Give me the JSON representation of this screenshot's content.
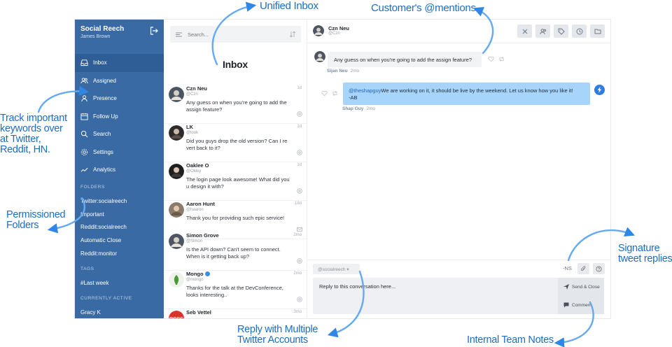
{
  "callouts": {
    "unified_inbox": "Unified Inbox",
    "customers_mentions": "Customer's @mentions",
    "track_keywords": "Track important keywords over at Twitter, Reddit, HN.",
    "permissioned_folders": "Permissioned Folders",
    "signature_replies": "Signature tweet replies",
    "reply_multiple": "Reply with Multiple Twitter Accounts",
    "team_notes": "Internal Team Notes",
    "inbox_label": "Inbox"
  },
  "sidebar": {
    "brand": "Social Reech",
    "user": "James Brown",
    "nav": [
      {
        "label": "Inbox",
        "icon": "inbox-icon",
        "active": true
      },
      {
        "label": "Assigned",
        "icon": "users-icon"
      },
      {
        "label": "Presence",
        "icon": "presence-icon"
      },
      {
        "label": "Follow Up",
        "icon": "calendar-icon"
      },
      {
        "label": "Search",
        "icon": "search-icon"
      },
      {
        "label": "Settings",
        "icon": "gear-icon"
      },
      {
        "label": "Analytics",
        "icon": "analytics-icon"
      }
    ],
    "folders_label": "FOLDERS",
    "folders": [
      "Twitter:socialreech",
      "Important",
      "Reddit:socialreech",
      "Automatic Close",
      "Reddit:monitor"
    ],
    "tags_label": "TAGS",
    "tags": [
      "#Last week"
    ],
    "active_label": "CURRENTLY ACTIVE",
    "active_users": [
      "Gracy K"
    ]
  },
  "list": {
    "search_placeholder": "Search...",
    "conversations": [
      {
        "name": "Czn Neu",
        "handle": "@Czn",
        "time": "1d",
        "text": "Any guess on when you're going to add the assign feature?",
        "icon": "at-icon"
      },
      {
        "name": "LK",
        "handle": "@look",
        "time": "1d",
        "text": "Did you guys drop the old version? Can I re vert back to it?",
        "icon": "at-icon"
      },
      {
        "name": "Oaklee O",
        "handle": "@Okley",
        "time": "1d",
        "text": "The login page look awesome! What did you u design it with?",
        "icon": "at-icon"
      },
      {
        "name": "Aaron Hunt",
        "handle": "@haaron",
        "time": "18d",
        "text": "Thank you for providing such epic service!",
        "icon": "mail-icon"
      },
      {
        "name": "Simon Grove",
        "handle": "@Simon",
        "time": "2mo",
        "text": "Is the API down? Can't seem to connect. When is it getting back up?",
        "icon": "at-icon"
      },
      {
        "name": "Mongo",
        "handle": "@mongo",
        "time": "2mo",
        "text": "Thanks for the talk at the DevConference, looks interesting..",
        "icon": "at-icon",
        "verified": true
      },
      {
        "name": "Seb Vettel",
        "handle": "",
        "time": "3mo",
        "text": "",
        "icon": ""
      }
    ]
  },
  "detail": {
    "name": "Czn Neu",
    "handle": "@Czn",
    "incoming": {
      "text": "Any guess on when you're going to add the assign feature?",
      "author": "Sijan Neu",
      "time": "2mo"
    },
    "outgoing": {
      "mention": "@theshapguy",
      "text": "We are working on it, it should be live by the weekend. Let us know how you like it!",
      "signature": "-AB",
      "author": "Shap Guy",
      "time": "2mo"
    },
    "account": "@socialreech",
    "signature_tag": "-NS",
    "reply_placeholder": "Reply to this conversation here...",
    "send_label": "Send & Close",
    "comment_label": "Comment"
  },
  "colors": {
    "sidebar": "#3a6aa4",
    "accent": "#1d6dc2",
    "outgoing_bubble": "#a6d4fb"
  }
}
